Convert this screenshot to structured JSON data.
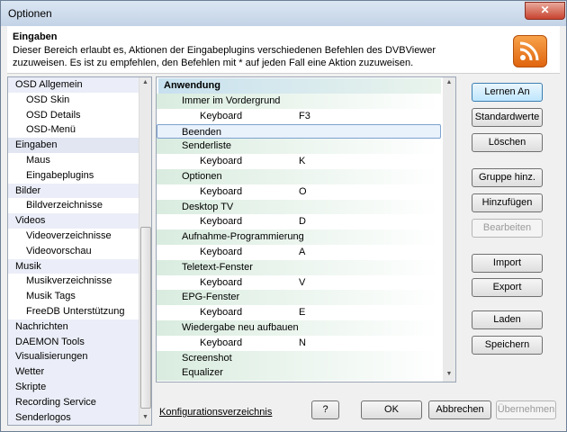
{
  "window": {
    "title": "Optionen",
    "close_symbol": "✕"
  },
  "header": {
    "title": "Eingaben",
    "text": "Dieser Bereich erlaubt es, Aktionen der Eingabeplugins verschiedenen Befehlen des DVBViewer zuzuweisen. Es ist zu empfehlen, den Befehlen mit * auf jeden Fall eine Aktion zuzuweisen.",
    "icon": "rss-icon"
  },
  "nav": {
    "items": [
      {
        "label": "OSD Allgemein",
        "level": 0
      },
      {
        "label": "OSD Skin",
        "level": 1
      },
      {
        "label": "OSD Details",
        "level": 1
      },
      {
        "label": "OSD-Menü",
        "level": 1
      },
      {
        "label": "Eingaben",
        "level": 0,
        "selected": true
      },
      {
        "label": "Maus",
        "level": 1
      },
      {
        "label": "Eingabeplugins",
        "level": 1
      },
      {
        "label": "Bilder",
        "level": 0
      },
      {
        "label": "Bildverzeichnisse",
        "level": 1
      },
      {
        "label": "Videos",
        "level": 0
      },
      {
        "label": "Videoverzeichnisse",
        "level": 1
      },
      {
        "label": "Videovorschau",
        "level": 1
      },
      {
        "label": "Musik",
        "level": 0
      },
      {
        "label": "Musikverzeichnisse",
        "level": 1
      },
      {
        "label": "Musik Tags",
        "level": 1
      },
      {
        "label": "FreeDB Unterstützung",
        "level": 1
      },
      {
        "label": "Nachrichten",
        "level": 0
      },
      {
        "label": "DAEMON Tools",
        "level": 0
      },
      {
        "label": "Visualisierungen",
        "level": 0
      },
      {
        "label": "Wetter",
        "level": 0
      },
      {
        "label": "Skripte",
        "level": 0
      },
      {
        "label": "Recording Service",
        "level": 0
      },
      {
        "label": "Senderlogos",
        "level": 0
      }
    ]
  },
  "list": {
    "group": "Anwendung",
    "rows": [
      {
        "type": "action",
        "label": "Immer im Vordergrund"
      },
      {
        "type": "shortcut",
        "device": "Keyboard",
        "key": "F3"
      },
      {
        "type": "action",
        "label": "Beenden",
        "selected": true
      },
      {
        "type": "action",
        "label": "Senderliste"
      },
      {
        "type": "shortcut",
        "device": "Keyboard",
        "key": "K"
      },
      {
        "type": "action",
        "label": "Optionen"
      },
      {
        "type": "shortcut",
        "device": "Keyboard",
        "key": "O"
      },
      {
        "type": "action",
        "label": "Desktop TV"
      },
      {
        "type": "shortcut",
        "device": "Keyboard",
        "key": "D"
      },
      {
        "type": "action",
        "label": "Aufnahme-Programmierung"
      },
      {
        "type": "shortcut",
        "device": "Keyboard",
        "key": "A"
      },
      {
        "type": "action",
        "label": "Teletext-Fenster"
      },
      {
        "type": "shortcut",
        "device": "Keyboard",
        "key": "V"
      },
      {
        "type": "action",
        "label": "EPG-Fenster"
      },
      {
        "type": "shortcut",
        "device": "Keyboard",
        "key": "E"
      },
      {
        "type": "action",
        "label": "Wiedergabe neu aufbauen"
      },
      {
        "type": "shortcut",
        "device": "Keyboard",
        "key": "N"
      },
      {
        "type": "action",
        "label": "Screenshot"
      },
      {
        "type": "action",
        "label": "Equalizer"
      }
    ]
  },
  "side_buttons": {
    "lernen": "Lernen An",
    "standardwerte": "Standardwerte",
    "loeschen": "Löschen",
    "gruppe": "Gruppe hinz.",
    "hinzufuegen": "Hinzufügen",
    "bearbeiten": "Bearbeiten",
    "import": "Import",
    "export": "Export",
    "laden": "Laden",
    "speichern": "Speichern"
  },
  "footer": {
    "link": "Konfigurationsverzeichnis",
    "help": "?",
    "ok": "OK",
    "abbrechen": "Abbrechen",
    "uebernehmen": "Übernehmen"
  }
}
